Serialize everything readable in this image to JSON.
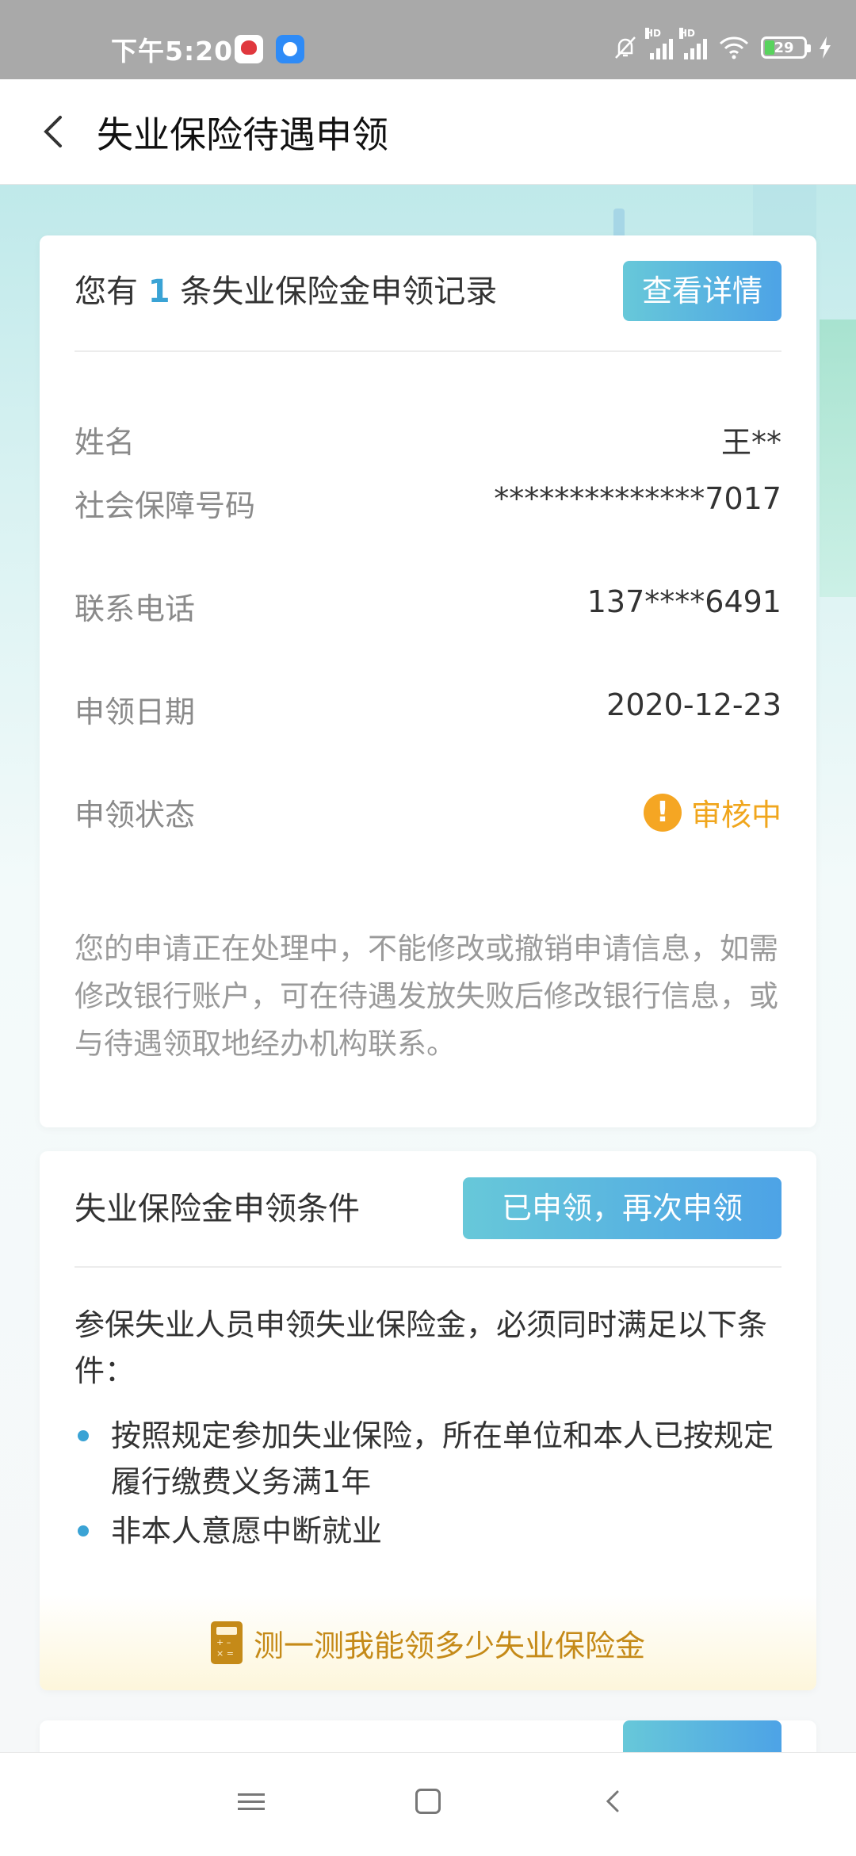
{
  "status_bar": {
    "time": "下午5:20",
    "battery": "29",
    "hd1": "HD",
    "hd2": "HD"
  },
  "header": {
    "title": "失业保险待遇申领"
  },
  "record_card": {
    "prefix": "您有",
    "count": "1",
    "suffix": "条失业保险金申领记录",
    "detail_button": "查看详情",
    "fields": [
      {
        "label": "姓名",
        "value": "王**"
      },
      {
        "label": "社会保障号码",
        "value": "**************7017"
      },
      {
        "label": "联系电话",
        "value": "137****6491"
      },
      {
        "label": "申领日期",
        "value": "2020-12-23"
      },
      {
        "label": "申领状态",
        "value": "审核中"
      }
    ],
    "status_icon": "!",
    "notice": "您的申请正在处理中，不能修改或撤销申请信息，如需修改银行账户，可在待遇发放失败后修改银行信息，或与待遇领取地经办机构联系。"
  },
  "conditions_card": {
    "title": "失业保险金申领条件",
    "reapply_button": "已申领，再次申领",
    "intro": "参保失业人员申领失业保险金，必须同时满足以下条件：",
    "items": [
      "按照规定参加失业保险，所在单位和本人已按规定履行缴费义务满1年",
      "非本人意愿中断就业"
    ],
    "calc_link": "测一测我能领多少失业保险金"
  },
  "colors": {
    "accent_blue": "#3aa3d5",
    "status_orange": "#f0a61d",
    "calc_gold": "#c58a18"
  }
}
